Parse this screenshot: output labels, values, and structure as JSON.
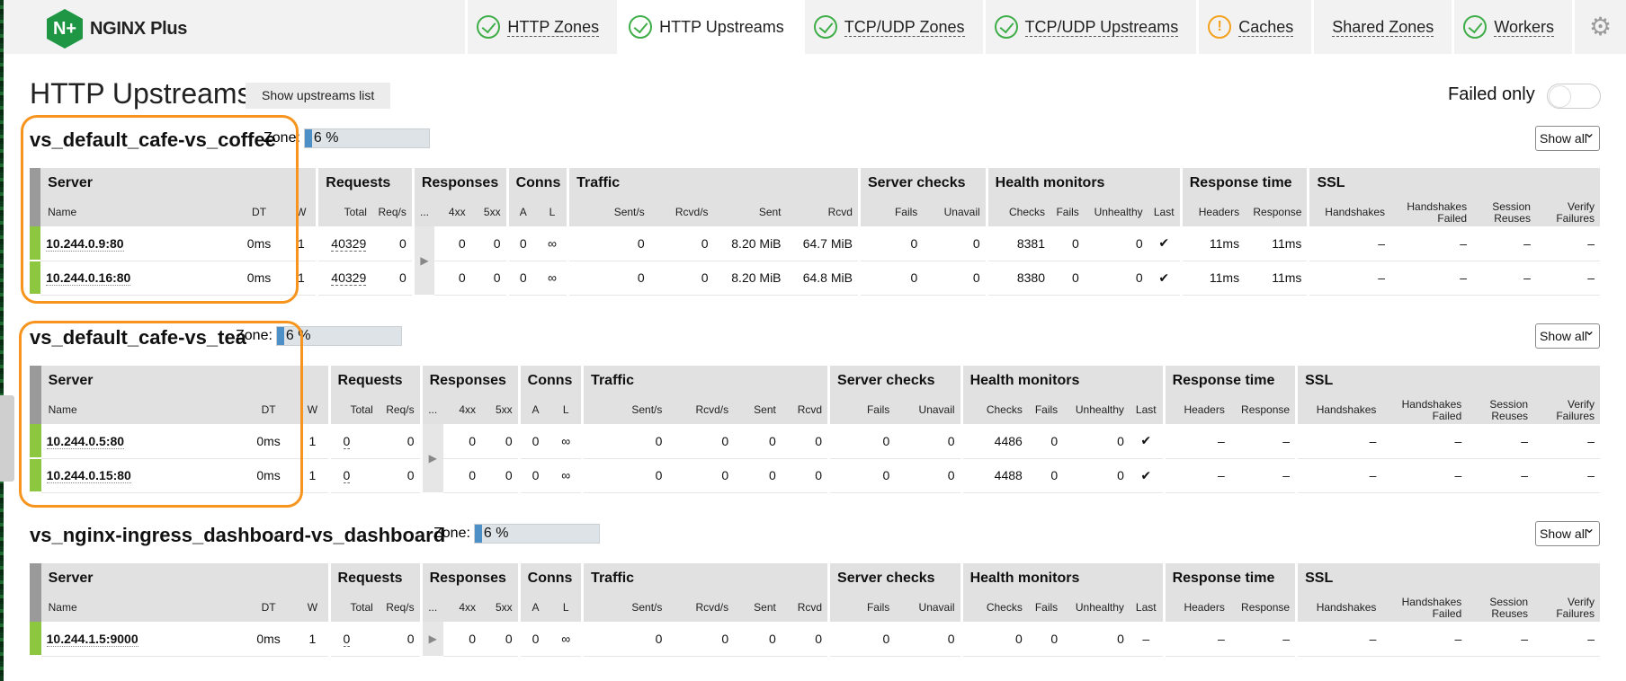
{
  "app": {
    "logo_mark": "N+",
    "logo_name": "NGINX Plus"
  },
  "nav": {
    "tabs": [
      {
        "label": "HTTP Zones",
        "status": "ok",
        "active": false
      },
      {
        "label": "HTTP Upstreams",
        "status": "ok",
        "active": true
      },
      {
        "label": "TCP/UDP Zones",
        "status": "ok",
        "active": false
      },
      {
        "label": "TCP/UDP Upstreams",
        "status": "ok",
        "active": false
      },
      {
        "label": "Caches",
        "status": "warning",
        "active": false
      },
      {
        "label": "Shared Zones",
        "status": "none",
        "active": false
      },
      {
        "label": "Workers",
        "status": "ok",
        "active": false
      }
    ],
    "settings_icon": "gear-icon"
  },
  "page": {
    "title": "HTTP Upstreams",
    "show_list_label": "Show upstreams list",
    "failed_only_label": "Failed only",
    "failed_only_on": false
  },
  "columns": {
    "groups": [
      "Server",
      "Requests",
      "Responses",
      "Conns",
      "Traffic",
      "Server checks",
      "Health monitors",
      "Response time",
      "SSL"
    ],
    "sub": {
      "name": "Name",
      "dt": "DT",
      "w": "W",
      "total": "Total",
      "reqs": "Req/s",
      "more": "...",
      "r4xx": "4xx",
      "r5xx": "5xx",
      "a": "A",
      "l": "L",
      "sent_s": "Sent/s",
      "rcvd_s": "Rcvd/s",
      "sent": "Sent",
      "rcvd": "Rcvd",
      "fails": "Fails",
      "unavail": "Unavail",
      "checks": "Checks",
      "hfails": "Fails",
      "unhealthy": "Unhealthy",
      "last": "Last",
      "headers": "Headers",
      "response": "Response",
      "handshakes": "Handshakes",
      "hs_failed": "Handshakes\nFailed",
      "sess_reuses": "Session\nReuses",
      "verify_failures": "Verify\nFailures"
    }
  },
  "upstreams": [
    {
      "name": "vs_default_cafe-vs_coffee",
      "zone_label": "Zone:",
      "zone_percent": 6,
      "zone_text": "6 %",
      "filter": "Show all",
      "servers": [
        {
          "name": "10.244.0.9:80",
          "dt": "0ms",
          "w": "1",
          "total": "40329",
          "reqs": "0",
          "r4xx": "0",
          "r5xx": "0",
          "a": "0",
          "l": "∞",
          "sent_s": "0",
          "rcvd_s": "0",
          "sent": "8.20 MiB",
          "rcvd": "64.7 MiB",
          "fails": "0",
          "unavail": "0",
          "checks": "8381",
          "hfails": "0",
          "unhealthy": "0",
          "last": "✔",
          "headers": "11ms",
          "response": "11ms",
          "handshakes": "–",
          "hs_failed": "–",
          "sess_reuses": "–",
          "verify_failures": "–"
        },
        {
          "name": "10.244.0.16:80",
          "dt": "0ms",
          "w": "1",
          "total": "40329",
          "reqs": "0",
          "r4xx": "0",
          "r5xx": "0",
          "a": "0",
          "l": "∞",
          "sent_s": "0",
          "rcvd_s": "0",
          "sent": "8.20 MiB",
          "rcvd": "64.8 MiB",
          "fails": "0",
          "unavail": "0",
          "checks": "8380",
          "hfails": "0",
          "unhealthy": "0",
          "last": "✔",
          "headers": "11ms",
          "response": "11ms",
          "handshakes": "–",
          "hs_failed": "–",
          "sess_reuses": "–",
          "verify_failures": "–"
        }
      ]
    },
    {
      "name": "vs_default_cafe-vs_tea",
      "zone_label": "Zone:",
      "zone_percent": 6,
      "zone_text": "6 %",
      "filter": "Show all",
      "servers": [
        {
          "name": "10.244.0.5:80",
          "dt": "0ms",
          "w": "1",
          "total": "0",
          "reqs": "0",
          "r4xx": "0",
          "r5xx": "0",
          "a": "0",
          "l": "∞",
          "sent_s": "0",
          "rcvd_s": "0",
          "sent": "0",
          "rcvd": "0",
          "fails": "0",
          "unavail": "0",
          "checks": "4486",
          "hfails": "0",
          "unhealthy": "0",
          "last": "✔",
          "headers": "–",
          "response": "–",
          "handshakes": "–",
          "hs_failed": "–",
          "sess_reuses": "–",
          "verify_failures": "–"
        },
        {
          "name": "10.244.0.15:80",
          "dt": "0ms",
          "w": "1",
          "total": "0",
          "reqs": "0",
          "r4xx": "0",
          "r5xx": "0",
          "a": "0",
          "l": "∞",
          "sent_s": "0",
          "rcvd_s": "0",
          "sent": "0",
          "rcvd": "0",
          "fails": "0",
          "unavail": "0",
          "checks": "4488",
          "hfails": "0",
          "unhealthy": "0",
          "last": "✔",
          "headers": "–",
          "response": "–",
          "handshakes": "–",
          "hs_failed": "–",
          "sess_reuses": "–",
          "verify_failures": "–"
        }
      ]
    },
    {
      "name": "vs_nginx-ingress_dashboard-vs_dashboard",
      "zone_label": "Zone:",
      "zone_percent": 6,
      "zone_text": "6 %",
      "filter": "Show all",
      "servers": [
        {
          "name": "10.244.1.5:9000",
          "dt": "0ms",
          "w": "1",
          "total": "0",
          "reqs": "0",
          "r4xx": "0",
          "r5xx": "0",
          "a": "0",
          "l": "∞",
          "sent_s": "0",
          "rcvd_s": "0",
          "sent": "0",
          "rcvd": "0",
          "fails": "0",
          "unavail": "0",
          "checks": "0",
          "hfails": "0",
          "unhealthy": "0",
          "last": "–",
          "headers": "–",
          "response": "–",
          "handshakes": "–",
          "hs_failed": "–",
          "sess_reuses": "–",
          "verify_failures": "–"
        }
      ]
    }
  ],
  "colors": {
    "ok": "#3fae49",
    "warning": "#f4a21e",
    "server_up": "#8dc63f",
    "zone_fill": "#4d90c8",
    "highlight": "#f7941d"
  }
}
